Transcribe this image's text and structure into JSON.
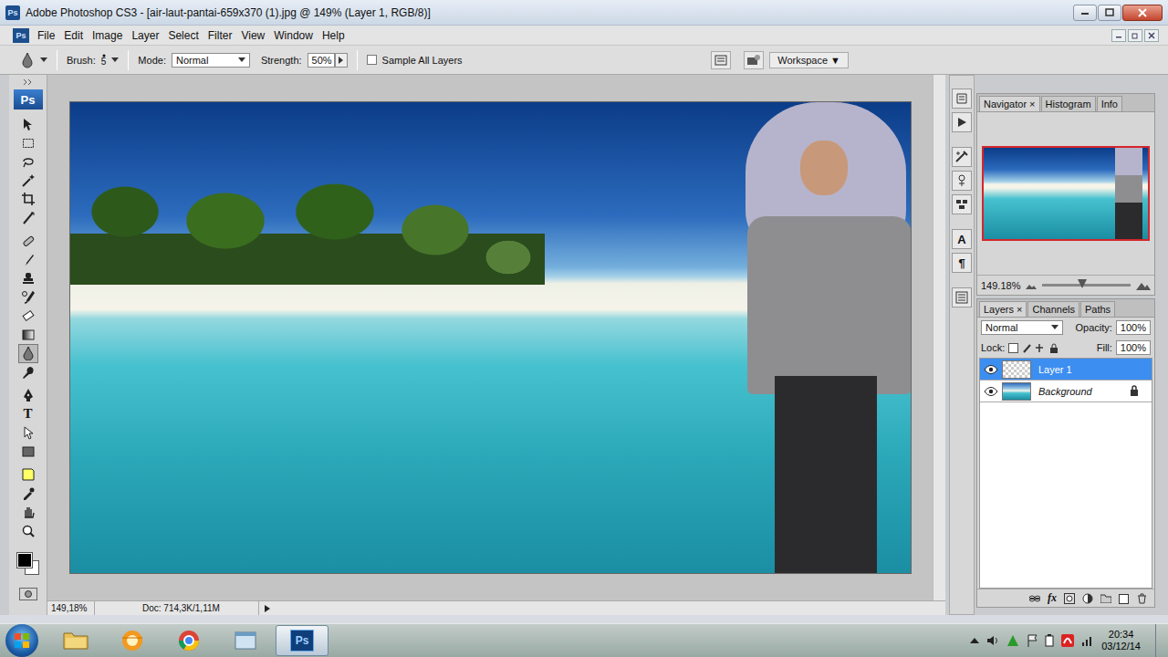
{
  "window": {
    "title": "Adobe Photoshop CS3 - [air-laut-pantai-659x370 (1).jpg @ 149% (Layer 1, RGB/8)]",
    "app_icon": "Ps"
  },
  "menu": {
    "app_icon": "Ps",
    "items": [
      "File",
      "Edit",
      "Image",
      "Layer",
      "Select",
      "Filter",
      "View",
      "Window",
      "Help"
    ]
  },
  "options_bar": {
    "brush_label": "Brush:",
    "brush_size": "5",
    "mode_label": "Mode:",
    "mode": "Normal",
    "strength_label": "Strength:",
    "strength": "50%",
    "sample_all_layers": {
      "label": "Sample All Layers",
      "checked": false
    },
    "workspace": "Workspace ▼"
  },
  "toolbox": {
    "logo": "Ps",
    "tools": [
      {
        "selected": false
      },
      {
        "selected": false
      },
      {
        "selected": false
      },
      {
        "selected": false
      },
      {
        "selected": false
      },
      {
        "selected": false
      },
      {
        "selected": false
      },
      {
        "selected": false
      },
      {
        "selected": false
      },
      {
        "selected": false
      },
      {
        "selected": false
      },
      {
        "selected": false
      },
      {
        "selected": true
      },
      {
        "selected": false
      },
      {
        "selected": false
      },
      {
        "selected": false,
        "glyph": "T"
      },
      {
        "selected": false
      },
      {
        "selected": false
      },
      {
        "selected": false
      },
      {
        "selected": false
      },
      {
        "selected": false
      },
      {
        "selected": false
      }
    ]
  },
  "dock": {
    "items": [
      {
        "glyph": ""
      },
      {
        "glyph": ""
      },
      {
        "glyph": ""
      },
      {
        "glyph": ""
      },
      {
        "glyph": ""
      },
      {
        "glyph": "A"
      },
      {
        "glyph": "¶"
      },
      {
        "glyph": ""
      }
    ]
  },
  "status_bar": {
    "zoom": "149,18%",
    "doc": "Doc: 714,3K/1,11M"
  },
  "navigator": {
    "tabs": [
      {
        "label": "Navigator",
        "selected": true,
        "close": "×"
      },
      {
        "label": "Histogram",
        "selected": false
      },
      {
        "label": "Info",
        "selected": false
      }
    ],
    "zoom": "149.18%",
    "level": 0.45
  },
  "layers_panel": {
    "tabs": [
      {
        "label": "Layers",
        "selected": true,
        "close": "×"
      },
      {
        "label": "Channels",
        "selected": false
      },
      {
        "label": "Paths",
        "selected": false
      }
    ],
    "blend_mode": "Normal",
    "opacity_label": "Opacity:",
    "opacity": "100%",
    "lock_label": "Lock:",
    "fill_label": "Fill:",
    "fill": "100%",
    "fx": "fx",
    "layers": [
      {
        "name": "Layer 1",
        "selected": true,
        "visible": true,
        "locked": false,
        "kind": "transparent"
      },
      {
        "name": "Background",
        "selected": false,
        "visible": true,
        "locked": true,
        "kind": "background"
      }
    ]
  },
  "taskbar": {
    "apps": [
      {
        "selected": false,
        "kind": "folder"
      },
      {
        "selected": false,
        "kind": "globe"
      },
      {
        "selected": false,
        "kind": "chrome"
      },
      {
        "selected": false,
        "kind": "window"
      },
      {
        "selected": true,
        "kind": "photoshop",
        "label": "Ps"
      }
    ],
    "clock": {
      "time": "20:34",
      "date": "03/12/14"
    }
  }
}
